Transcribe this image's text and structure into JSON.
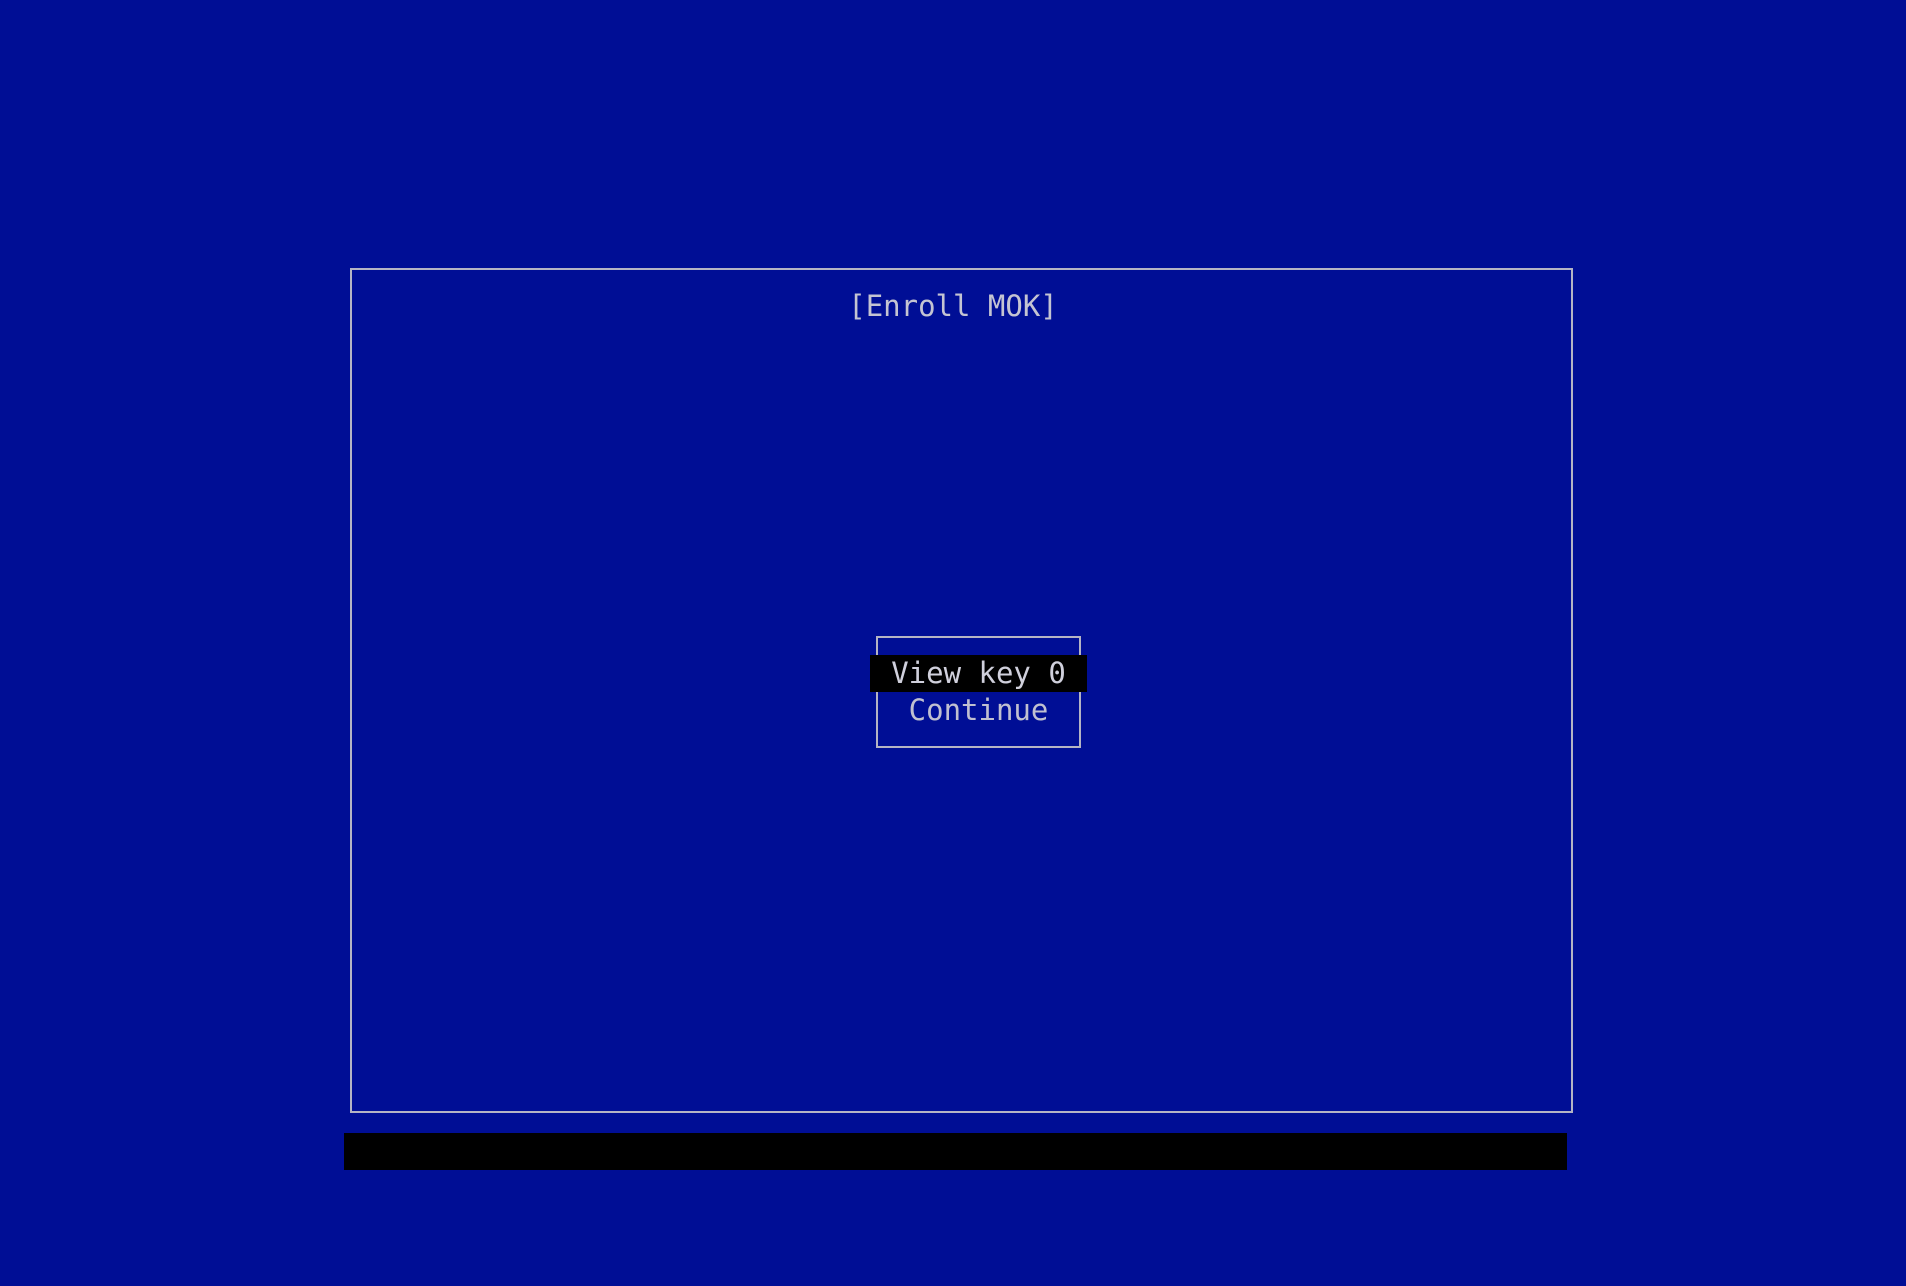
{
  "window": {
    "title": "[Enroll MOK]"
  },
  "menu": {
    "items": [
      {
        "label": "View key 0",
        "selected": true
      },
      {
        "label": "Continue",
        "selected": false
      }
    ]
  },
  "status_bar": {
    "text": ""
  },
  "colors": {
    "background": "#000e95",
    "border": "#b4b4c4",
    "text": "#c0c0d0",
    "highlight": "#000000"
  }
}
